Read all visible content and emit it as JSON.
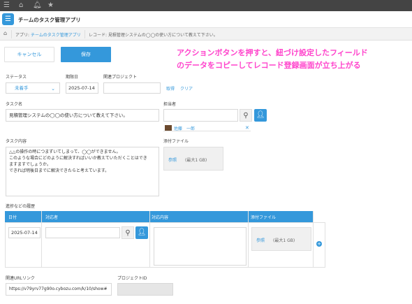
{
  "app": {
    "title": "チームのタスク管理アプリ"
  },
  "breadcrumb": {
    "app_label": "アプリ: ",
    "app_link": "チームのタスク管理アプリ",
    "record_label": "レコード: 見積管理システムの◯◯の使い方について教えて下さい。"
  },
  "toolbar": {
    "cancel_label": "キャンセル",
    "save_label": "保存"
  },
  "annotation": {
    "line1": "アクションボタンを押すと、紐づけ設定したフィールド",
    "line2": "のデータをコピーしてレコード登録画面が立ち上がる"
  },
  "form": {
    "status": {
      "label": "ステータス",
      "value": "未着手"
    },
    "due": {
      "label": "期限日",
      "value": "2025-07-14"
    },
    "project": {
      "label": "関連プロジェクト",
      "value": "",
      "fetch_label": "取得",
      "clear_label": "クリア"
    },
    "task_name": {
      "label": "タスク名",
      "value": "見積管理システムの◯◯の使い方について教えて下さい。"
    },
    "assignee": {
      "label": "担当者",
      "selected": "佐藤　一郎",
      "remove": "✕"
    },
    "task_content": {
      "label": "タスク内容",
      "value": "△△の操作の時につまずいてしまって、◯◯ができません。\nこのような場合にどのように解決すればいいか教えていただくことはでき\nますますでしょうか。\nできれば明後日までに解決できたらと考えています。"
    },
    "attachment": {
      "label": "添付ファイル",
      "browse": "参照",
      "max": "(最大1 GB)"
    },
    "history": {
      "label": "進捗などの履歴",
      "columns": [
        "日付",
        "対応者",
        "対応内容",
        "添付ファイル"
      ],
      "row": {
        "date": "2025-07-14",
        "responder": "",
        "content": "",
        "browse": "参照",
        "max": "(最大1 GB)"
      }
    },
    "related_url": {
      "label": "関連URLリンク",
      "value": "https://v79yrv77g90o.cybozu.com/k/10/show#"
    },
    "project_id": {
      "label": "プロジェクトID",
      "value": ""
    }
  },
  "colors": {
    "accent": "#3498db",
    "annotation": "#ff44cc",
    "topbar": "#444444"
  },
  "icons": [
    "menu-icon",
    "home-icon",
    "bell-icon",
    "star-icon",
    "app-list-icon",
    "search-icon",
    "user-icon",
    "plus-icon"
  ]
}
